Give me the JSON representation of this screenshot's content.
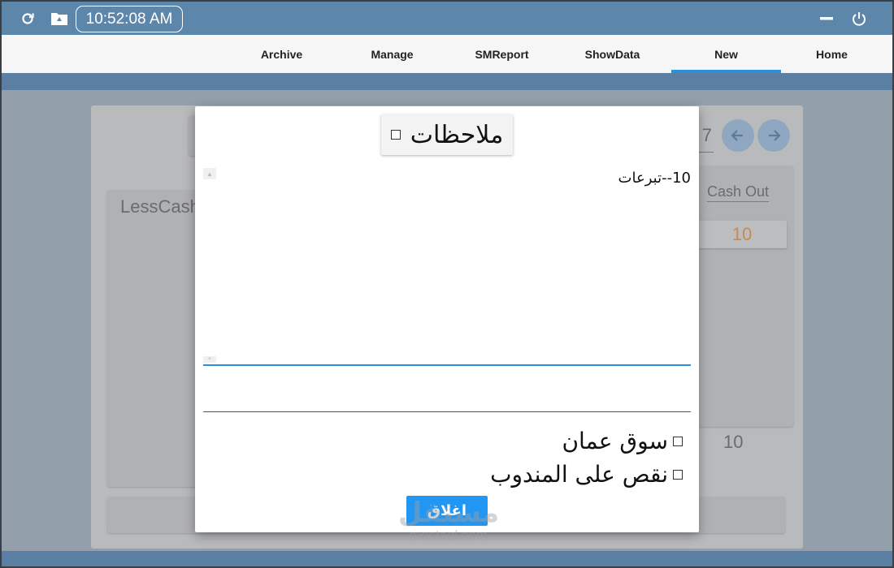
{
  "titlebar": {
    "clock": "10:52:08 AM",
    "icons": [
      "refresh-icon",
      "folder-icon",
      "minimize-icon",
      "power-icon"
    ]
  },
  "nav": {
    "tabs": [
      {
        "label": "Archive"
      },
      {
        "label": "Manage"
      },
      {
        "label": "SMReport"
      },
      {
        "label": "ShowData"
      },
      {
        "label": "New"
      },
      {
        "label": "Home"
      }
    ],
    "active": "New"
  },
  "background": {
    "lesscash_label": "LessCash",
    "cashout_label": "Cash Out",
    "cashout_value": "10",
    "total_value": "10",
    "partial_value": "7"
  },
  "modal": {
    "title": "ملاحظات",
    "notes_text": "10--تبرعات",
    "options": [
      {
        "label": "سوق عمان",
        "checked": false
      },
      {
        "label": "نقص على المندوب",
        "checked": false
      }
    ],
    "close_label": "اغلاق"
  },
  "watermark": {
    "main": "مستقل",
    "sub": "mostaql.com"
  },
  "colors": {
    "titlebar": "#5d86ab",
    "accent": "#2196f3",
    "tab_indicator": "#2d8fd8",
    "value_orange": "#c98a4c"
  }
}
